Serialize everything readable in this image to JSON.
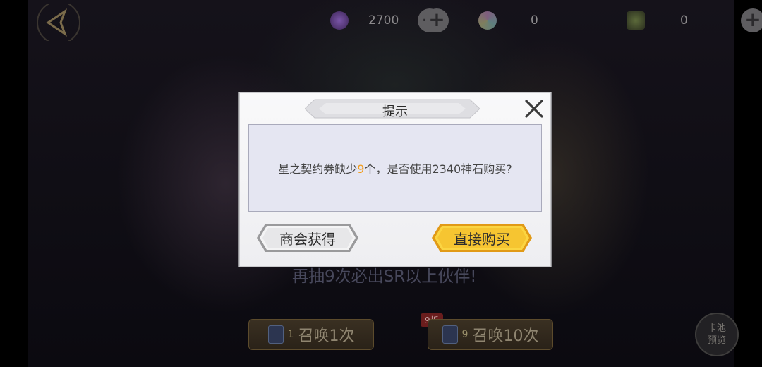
{
  "resources": [
    {
      "icon": "purple-crystal-icon",
      "amount": "2700"
    },
    {
      "icon": "rainbow-orb-icon",
      "amount": "0"
    },
    {
      "icon": "star-ticket-icon",
      "amount": "0"
    }
  ],
  "background": {
    "pity_text": "再抽9次必出SR以上伙伴!",
    "summon_one": {
      "count": "1",
      "label": "召唤1次"
    },
    "summon_ten": {
      "count": "9",
      "label": "召唤10次",
      "badge": "9折"
    },
    "preview_label": "卡池预览"
  },
  "dialog": {
    "title": "提示",
    "message_part1": "星之契约券缺少",
    "message_number": "9",
    "message_part2": "个，是否使用2340神石购买?",
    "secondary_button": "商会获得",
    "primary_button": "直接购买"
  },
  "colors": {
    "highlight": "#f29b18",
    "primary_button": "#f6c531",
    "panel": "#e5e6f2"
  }
}
